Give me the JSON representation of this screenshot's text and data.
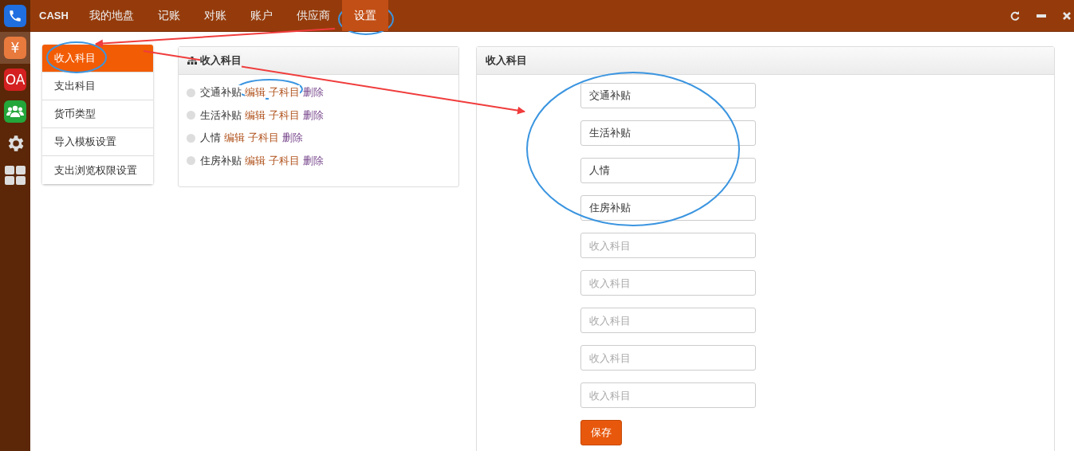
{
  "app_dock": [
    {
      "kind": "phone",
      "selected": false
    },
    {
      "kind": "text",
      "label": "¥",
      "selected": true
    },
    {
      "kind": "text",
      "label": "OA",
      "selected": false
    },
    {
      "kind": "people",
      "selected": false
    },
    {
      "kind": "gear",
      "selected": false
    },
    {
      "kind": "grid",
      "selected": false
    }
  ],
  "top_nav": {
    "brand": "CASH",
    "tabs": [
      {
        "label": "我的地盘",
        "selected": false
      },
      {
        "label": "记账",
        "selected": false
      },
      {
        "label": "对账",
        "selected": false
      },
      {
        "label": "账户",
        "selected": false
      },
      {
        "label": "供应商",
        "selected": false
      },
      {
        "label": "设置",
        "selected": true
      }
    ]
  },
  "side_menu": [
    {
      "label": "收入科目",
      "selected": true
    },
    {
      "label": "支出科目",
      "selected": false
    },
    {
      "label": "货币类型",
      "selected": false
    },
    {
      "label": "导入模板设置",
      "selected": false
    },
    {
      "label": "支出浏览权限设置",
      "selected": false
    }
  ],
  "tree_panel": {
    "title": "收入科目",
    "items": [
      {
        "name": "交通补贴",
        "actions": [
          {
            "label": "编辑",
            "kind": "edit"
          },
          {
            "label": "子科目",
            "kind": "sub"
          },
          {
            "label": "删除",
            "kind": "delete"
          }
        ]
      },
      {
        "name": "生活补贴",
        "actions": [
          {
            "label": "编辑",
            "kind": "edit"
          },
          {
            "label": "子科目",
            "kind": "sub"
          },
          {
            "label": "删除",
            "kind": "delete"
          }
        ]
      },
      {
        "name": "人情",
        "actions": [
          {
            "label": "编辑",
            "kind": "edit"
          },
          {
            "label": "子科目",
            "kind": "sub"
          },
          {
            "label": "删除",
            "kind": "delete"
          }
        ]
      },
      {
        "name": "住房补贴",
        "actions": [
          {
            "label": "编辑",
            "kind": "edit"
          },
          {
            "label": "子科目",
            "kind": "sub"
          },
          {
            "label": "删除",
            "kind": "delete"
          }
        ]
      }
    ]
  },
  "form_panel": {
    "title": "收入科目",
    "fields": [
      {
        "value": "交通补贴"
      },
      {
        "value": "生活补贴"
      },
      {
        "value": "人情"
      },
      {
        "value": "住房补贴"
      },
      {
        "placeholder": "收入科目"
      },
      {
        "placeholder": "收入科目"
      },
      {
        "placeholder": "收入科目"
      },
      {
        "placeholder": "收入科目"
      },
      {
        "placeholder": "收入科目"
      }
    ],
    "save_button": "保存"
  }
}
